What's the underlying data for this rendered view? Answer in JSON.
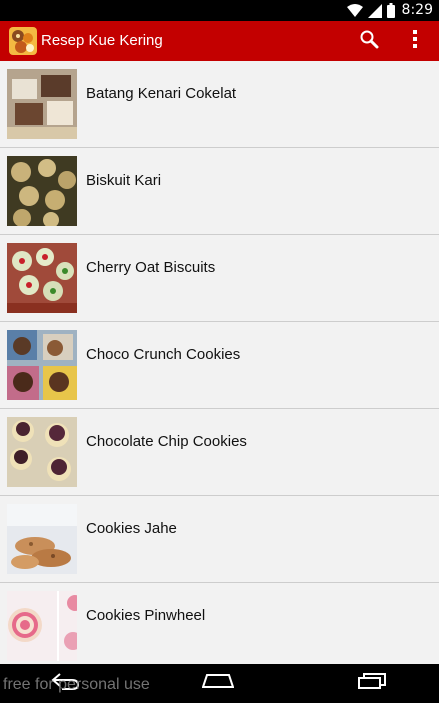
{
  "status_bar": {
    "time": "8:29",
    "icons": [
      "wifi-icon",
      "signal-icon",
      "battery-icon"
    ]
  },
  "action_bar": {
    "title": "Resep Kue Kering",
    "background": "#c30000",
    "actions": [
      "search-icon",
      "overflow-menu-icon"
    ]
  },
  "list": {
    "items": [
      {
        "label": "Batang Kenari Cokelat"
      },
      {
        "label": "Biskuit Kari"
      },
      {
        "label": "Cherry Oat Biscuits"
      },
      {
        "label": "Choco Crunch Cookies"
      },
      {
        "label": "Chocolate Chip Cookies"
      },
      {
        "label": "Cookies Jahe"
      },
      {
        "label": "Cookies Pinwheel"
      }
    ]
  },
  "nav_bar": {
    "buttons": [
      "back-icon",
      "home-icon",
      "recents-icon"
    ]
  },
  "watermark": "free for personal use"
}
